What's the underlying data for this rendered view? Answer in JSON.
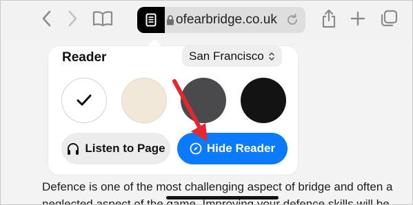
{
  "toolbar": {
    "url_text": "ofearbridge.co.uk"
  },
  "reader_popover": {
    "title": "Reader",
    "font_select_label": "San Francisco",
    "themes": [
      {
        "name": "white",
        "color": "#ffffff",
        "selected": true
      },
      {
        "name": "sepia",
        "color": "#f2e8da",
        "selected": false
      },
      {
        "name": "gray",
        "color": "#4a4a4c",
        "selected": false
      },
      {
        "name": "black",
        "color": "#131313",
        "selected": false
      }
    ],
    "listen_label": "Listen to Page",
    "hide_label": "Hide Reader"
  },
  "page_body": {
    "line1": "Defence is one of the most challenging aspect of bridge and often a",
    "line2": "neglected aspect of the game. Improving your defence skills will be"
  },
  "colors": {
    "accent": "#0a7aff",
    "annotation_arrow": "#e8262e"
  }
}
